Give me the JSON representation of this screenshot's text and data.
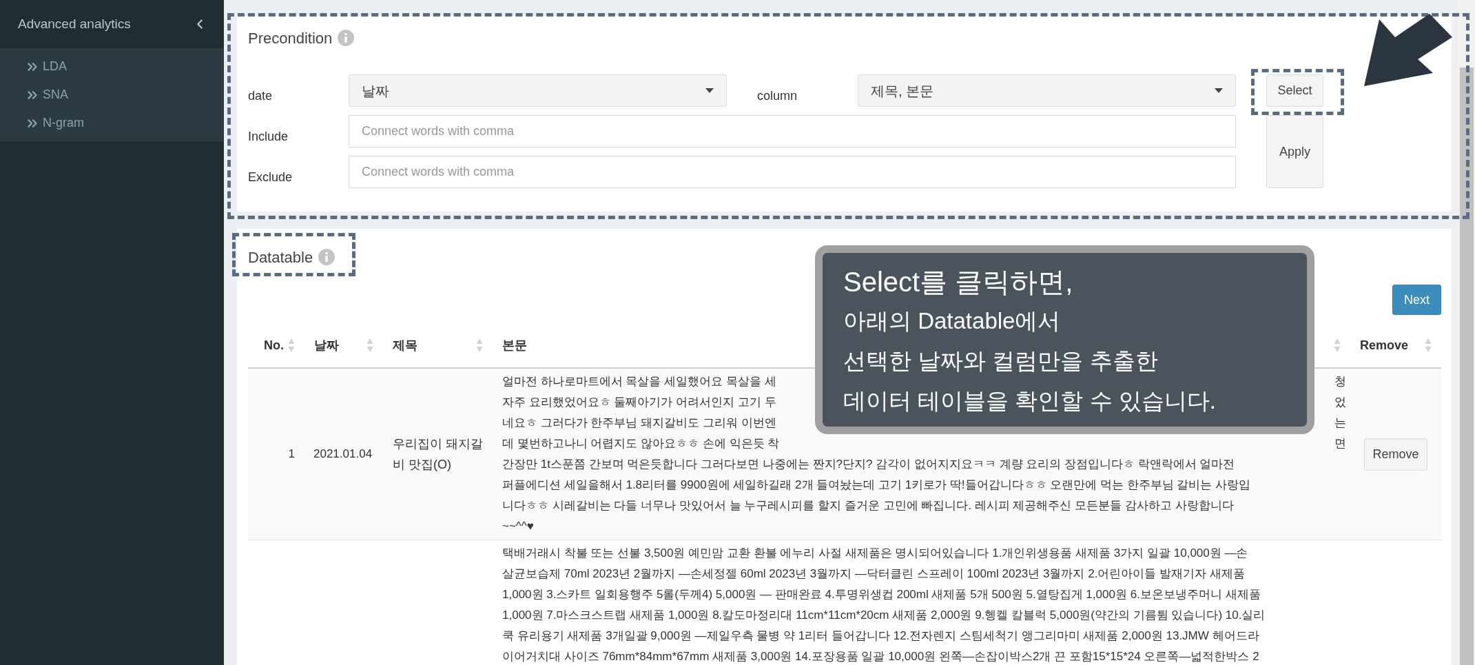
{
  "sidebar": {
    "title": "Advanced analytics",
    "items": [
      {
        "label": "LDA"
      },
      {
        "label": "SNA"
      },
      {
        "label": "N-gram"
      }
    ]
  },
  "precondition": {
    "title": "Precondition",
    "date": {
      "label": "date",
      "value": "날짜"
    },
    "column": {
      "label": "column",
      "value": "제목, 본문"
    },
    "include": {
      "label": "Include",
      "placeholder": "Connect words with comma"
    },
    "exclude": {
      "label": "Exclude",
      "placeholder": "Connect words with comma"
    },
    "select_button": "Select",
    "apply_button": "Apply"
  },
  "datatable": {
    "title": "Datatable",
    "next_button": "Next",
    "columns": [
      {
        "label": "No.",
        "sortable": true
      },
      {
        "label": "날짜",
        "sortable": true
      },
      {
        "label": "제목",
        "sortable": true
      },
      {
        "label": "본문",
        "sortable": true
      },
      {
        "label": "Remove",
        "sortable": true
      }
    ],
    "rows": [
      {
        "no": "1",
        "date": "2021.01.04",
        "title": "우리집이 돼지갈비 맛집(O)",
        "remove_button": "Remove",
        "body_lines": [
          [
            "얼마전 하나로마트에서 목살을 세일했어요 목살을 세",
            "청"
          ],
          [
            "자주 요리했었어요ㅎ 둘째아기가 어려서인지 고기 두",
            "었"
          ],
          [
            "네요ㅎ 그러다가 한주부님 돼지갈비도 그리워 이번엔",
            "는"
          ],
          [
            "데 몇번하고나니 어렵지도 않아요ㅎㅎ 손에 익은듯 착",
            "면"
          ],
          [
            "간장만 1t스푼쯤 간보며 먹은듯합니다 그러다보면 나중에는 짠지?단지? 감각이 없어지지요ㅋㅋ 계량 요리의 장점입니다ㅎ 락앤락에서 얼마전"
          ],
          [
            "퍼플에디션 세일을해서 1.8리터를 9900원에 세일하길래 2개 들여놨는데 고기 1키로가 딱!들어갑니다ㅎㅎ 오랜만에 먹는 한주부님 갈비는 사랑입"
          ],
          [
            "니다ㅎㅎ 시레갈비는 다들 너무나 맛있어서 늘 누구레시피를 할지 즐거운 고민에 빠집니다. 레시피 제공해주신 모든분들 감사하고 사랑합니다"
          ],
          [
            "~~^^♥"
          ]
        ]
      },
      {
        "body_lines": [
          [
            "택배거래시 착불 또는 선불 3,500원 예민맘 교환 환불 에누리 사절 새제품은 명시되어있습니다 1.개인위생용품 새제품 3가지 일괄 10,000원 —손"
          ],
          [
            "살균보습제 70ml 2023년 2월까지 —손세정젤 60ml 2023년 3월까지 —닥터클린 스프레이 100ml 2023년 3월까지 2.어린아이들 발재기자 새제품"
          ],
          [
            "1,000원 3.스카트 일회용행주 5롤(두께4) 5,000원 — 판매완료 4.투명위생컵 200ml 새제품 5개 500원 5.열탕집게 1,000원 6.보온보냉주머니 새제품"
          ],
          [
            "1,000원 7.마스크스트랩 새제품 1,000원 8.칼도마정리대 11cm*11cm*20cm 새제품 2,000원 9.헹켈 칼블럭 5,000원(약간의 기름튐 있습니다) 10.실리"
          ],
          [
            "쿡 유리용기 새제품 3개일괄 9,000원 —제일우측 물병 약 1리터 들어갑니다 12.전자렌지 스팀세척기 앵그리마미 새제품 2,000원 13.JMW 헤어드라"
          ],
          [
            "이어거치대 사이즈 76mm*84mm*67mm 새제품 3,000원 14.포장용품 일괄 10,000원 왼쪽—손잡이박스2개 끈 포함15*15*24 오른쪽—넓적한박스 2"
          ]
        ]
      }
    ]
  },
  "callout": {
    "heading": "Select를 클릭하면,",
    "lines": [
      "아래의 Datatable에서",
      "선택한 날짜와 컬럼만을 추출한",
      "데이터 테이블을 확인할 수 있습니다."
    ]
  }
}
